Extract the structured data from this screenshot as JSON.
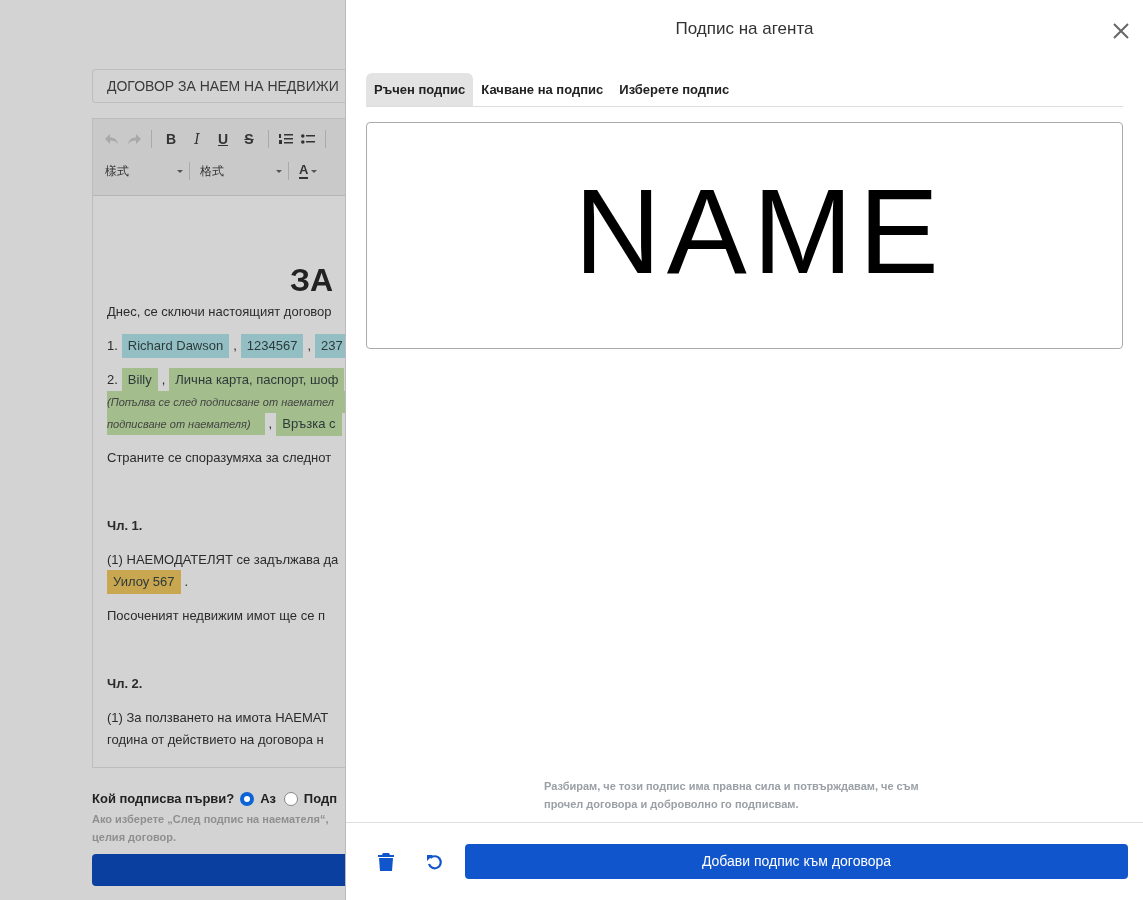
{
  "document": {
    "title_field": "ДОГОВОР ЗА НАЕМ НА НЕДВИЖИ",
    "toolbar": {
      "undo_disabled": true,
      "redo_disabled": true,
      "format_buttons": [
        {
          "kind": "bold",
          "label": "B"
        },
        {
          "kind": "italic",
          "label": "I"
        },
        {
          "kind": "underline",
          "label": "U"
        },
        {
          "kind": "strike",
          "label": "S"
        }
      ],
      "style_select": "樣式",
      "format_select": "格式",
      "color_button": "A"
    },
    "heading": "ЗА",
    "blocks": [
      {
        "kind": "p",
        "lines": [
          [
            {
              "kind": "plain",
              "text": "Днес, се сключи настоящият договор"
            }
          ]
        ]
      },
      {
        "kind": "p",
        "lines": [
          [
            {
              "kind": "plain",
              "text": "1."
            },
            {
              "kind": "field",
              "text": "Richard Dawson",
              "color": "#93bfc4"
            },
            {
              "kind": "plain",
              "text": ","
            },
            {
              "kind": "field",
              "text": "1234567",
              "color": "#93bfc4"
            },
            {
              "kind": "plain",
              "text": ","
            },
            {
              "kind": "field",
              "text": "237",
              "color": "#93bfc4"
            }
          ]
        ]
      },
      {
        "kind": "p",
        "lines": [
          [
            {
              "kind": "plain",
              "text": "2."
            },
            {
              "kind": "field",
              "text": "Billy",
              "color": "#a3bd8c"
            },
            {
              "kind": "plain",
              "text": ","
            },
            {
              "kind": "field",
              "text": "Лична карта, паспорт, шоф",
              "color": "#a3bd8c"
            }
          ],
          [
            {
              "kind": "note",
              "text": "(Попълва се след подписване от наемател",
              "color": "#a3bd8c"
            }
          ],
          [
            {
              "kind": "note",
              "text": "подписване от наемателя)",
              "color": "#a3bd8c"
            },
            {
              "kind": "plain",
              "text": ","
            },
            {
              "kind": "field",
              "text": "Връзка с",
              "color": "#a3bd8c"
            }
          ]
        ]
      },
      {
        "kind": "p",
        "lines": [
          [
            {
              "kind": "plain",
              "text": "Страните се споразумяха за следнот"
            }
          ]
        ]
      },
      {
        "kind": "gap"
      },
      {
        "kind": "heading",
        "lines": [
          [
            {
              "kind": "plain",
              "text": "Чл. 1."
            }
          ]
        ]
      },
      {
        "kind": "p",
        "lines": [
          [
            {
              "kind": "plain",
              "text": "(1) НАЕМОДАТЕЛЯТ се задължава да"
            }
          ],
          [
            {
              "kind": "field",
              "text": "Уилоу 567",
              "color": "#c9a650"
            },
            {
              "kind": "plain",
              "text": "."
            }
          ]
        ]
      },
      {
        "kind": "p",
        "lines": [
          [
            {
              "kind": "plain",
              "text": "Посоченият недвижим имот ще се п"
            }
          ]
        ]
      },
      {
        "kind": "gap"
      },
      {
        "kind": "heading",
        "lines": [
          [
            {
              "kind": "plain",
              "text": "Чл. 2."
            }
          ]
        ]
      },
      {
        "kind": "p",
        "lines": [
          [
            {
              "kind": "plain",
              "text": "(1) За ползването на имота НАЕМАТ"
            }
          ],
          [
            {
              "kind": "plain",
              "text": "година от действието на договора н"
            }
          ]
        ]
      }
    ],
    "signer_question": "Кой подписва първи?",
    "signer_options": [
      {
        "label": "Аз",
        "selected": true
      },
      {
        "label": "Подп",
        "selected": false
      }
    ],
    "signer_hint": "Ако изберете „След подпис на наемателя“,",
    "signer_hint_2": "целия договор."
  },
  "dialog": {
    "title": "Подпис на агента",
    "tabs": [
      {
        "label": "Ръчен подпис",
        "selected": true
      },
      {
        "label": "Качване на подпис",
        "selected": false
      },
      {
        "label": "Изберете подпис",
        "selected": false
      }
    ],
    "signature": "NAME",
    "disclaimer": "Разбирам, че този подпис има правна сила и потвърждавам, че съм прочел договора и доброволно го подписвам.",
    "submit_button": "Добави подпис към договора"
  }
}
